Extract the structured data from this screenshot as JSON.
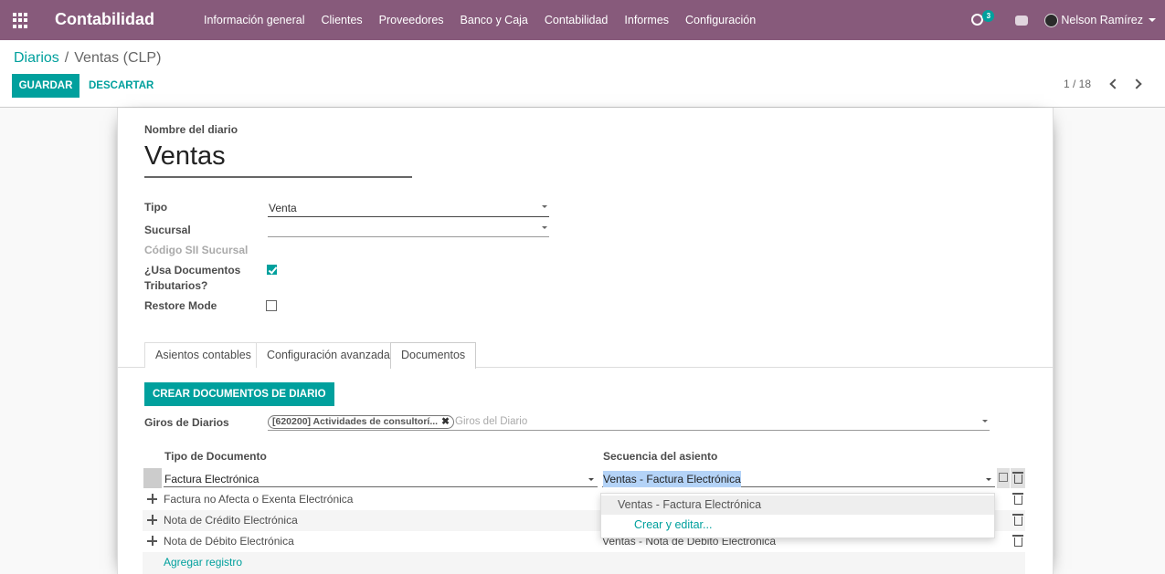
{
  "navbar": {
    "app_title": "Contabilidad",
    "menu": [
      "Información general",
      "Clientes",
      "Proveedores",
      "Banco y Caja",
      "Contabilidad",
      "Informes",
      "Configuración"
    ],
    "activity_count": "3",
    "user_name": "Nelson Ramírez"
  },
  "breadcrumb": {
    "parent": "Diarios",
    "current": "Ventas (CLP)"
  },
  "actions": {
    "save": "GUARDAR",
    "discard": "DESCARTAR"
  },
  "pager": {
    "value": "1 / 18"
  },
  "form": {
    "name_label": "Nombre del diario",
    "name_value": "Ventas",
    "tipo_label": "Tipo",
    "tipo_value": "Venta",
    "sucursal_label": "Sucursal",
    "sucursal_value": "",
    "codigo_label": "Código SII Sucursal",
    "usa_docs_label_1": "¿Usa Documentos",
    "usa_docs_label_2": "Tributarios?",
    "usa_docs_checked": true,
    "restore_label": "Restore Mode",
    "restore_checked": false
  },
  "tabs": [
    "Asientos contables",
    "Configuración avanzada",
    "Documentos"
  ],
  "active_tab": "Documentos",
  "documents": {
    "create_button": "CREAR DOCUMENTOS DE DIARIO",
    "giros_label": "Giros de Diarios",
    "giros_tag": "[620200] Actividades de consultorí...",
    "giros_placeholder": "Giros del Diario",
    "col_tipo": "Tipo de Documento",
    "col_secuencia": "Secuencia del asiento",
    "editing_row": {
      "tipo": "Factura Electrónica",
      "secuencia": "Ventas - Factura Electrónica"
    },
    "rows": [
      {
        "tipo": "Factura no Afecta o Exenta Electrónica",
        "secuencia": ""
      },
      {
        "tipo": "Nota de Crédito Electrónica",
        "secuencia": ""
      },
      {
        "tipo": "Nota de Débito Electrónica",
        "secuencia": "Ventas - Nota de Débito Electrónica"
      }
    ],
    "add_line": "Agregar registro",
    "autocomplete": [
      "Ventas - Factura Electrónica",
      "Crear y editar..."
    ]
  },
  "colors": {
    "primary": "#875a7b",
    "accent": "#00a09d"
  }
}
